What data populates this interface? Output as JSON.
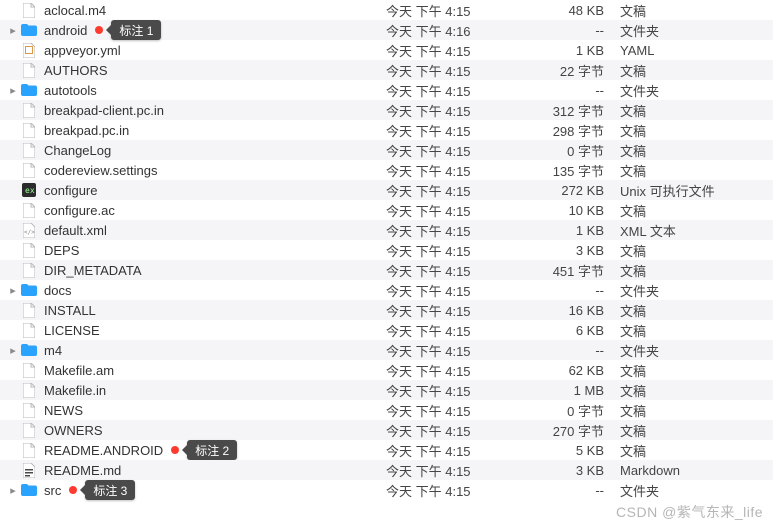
{
  "icon_colors": {
    "folder": "#2aa3ff",
    "file_border": "#b9b9b9",
    "file_fill": "#ffffff",
    "exec_fill": "#2b2b2b",
    "md_bar": "#4a4a4a"
  },
  "watermark": "CSDN @紫气东来_life",
  "rows": [
    {
      "name": "aclocal.m4",
      "date": "今天 下午 4:15",
      "size": "48 KB",
      "kind": "文稿",
      "icon": "file",
      "expandable": false,
      "marked": false,
      "annot": null
    },
    {
      "name": "android",
      "date": "今天 下午 4:16",
      "size": "--",
      "kind": "文件夹",
      "icon": "folder",
      "expandable": true,
      "marked": true,
      "annot": "标注 1"
    },
    {
      "name": "appveyor.yml",
      "date": "今天 下午 4:15",
      "size": "1 KB",
      "kind": "YAML",
      "icon": "yaml",
      "expandable": false,
      "marked": false,
      "annot": null
    },
    {
      "name": "AUTHORS",
      "date": "今天 下午 4:15",
      "size": "22 字节",
      "kind": "文稿",
      "icon": "file",
      "expandable": false,
      "marked": false,
      "annot": null
    },
    {
      "name": "autotools",
      "date": "今天 下午 4:15",
      "size": "--",
      "kind": "文件夹",
      "icon": "folder",
      "expandable": true,
      "marked": false,
      "annot": null
    },
    {
      "name": "breakpad-client.pc.in",
      "date": "今天 下午 4:15",
      "size": "312 字节",
      "kind": "文稿",
      "icon": "file",
      "expandable": false,
      "marked": false,
      "annot": null
    },
    {
      "name": "breakpad.pc.in",
      "date": "今天 下午 4:15",
      "size": "298 字节",
      "kind": "文稿",
      "icon": "file",
      "expandable": false,
      "marked": false,
      "annot": null
    },
    {
      "name": "ChangeLog",
      "date": "今天 下午 4:15",
      "size": "0 字节",
      "kind": "文稿",
      "icon": "file",
      "expandable": false,
      "marked": false,
      "annot": null
    },
    {
      "name": "codereview.settings",
      "date": "今天 下午 4:15",
      "size": "135 字节",
      "kind": "文稿",
      "icon": "file",
      "expandable": false,
      "marked": false,
      "annot": null
    },
    {
      "name": "configure",
      "date": "今天 下午 4:15",
      "size": "272 KB",
      "kind": "Unix 可执行文件",
      "icon": "exec",
      "expandable": false,
      "marked": false,
      "annot": null
    },
    {
      "name": "configure.ac",
      "date": "今天 下午 4:15",
      "size": "10 KB",
      "kind": "文稿",
      "icon": "file",
      "expandable": false,
      "marked": false,
      "annot": null
    },
    {
      "name": "default.xml",
      "date": "今天 下午 4:15",
      "size": "1 KB",
      "kind": "XML 文本",
      "icon": "xml",
      "expandable": false,
      "marked": false,
      "annot": null
    },
    {
      "name": "DEPS",
      "date": "今天 下午 4:15",
      "size": "3 KB",
      "kind": "文稿",
      "icon": "file",
      "expandable": false,
      "marked": false,
      "annot": null
    },
    {
      "name": "DIR_METADATA",
      "date": "今天 下午 4:15",
      "size": "451 字节",
      "kind": "文稿",
      "icon": "file",
      "expandable": false,
      "marked": false,
      "annot": null
    },
    {
      "name": "docs",
      "date": "今天 下午 4:15",
      "size": "--",
      "kind": "文件夹",
      "icon": "folder",
      "expandable": true,
      "marked": false,
      "annot": null
    },
    {
      "name": "INSTALL",
      "date": "今天 下午 4:15",
      "size": "16 KB",
      "kind": "文稿",
      "icon": "file",
      "expandable": false,
      "marked": false,
      "annot": null
    },
    {
      "name": "LICENSE",
      "date": "今天 下午 4:15",
      "size": "6 KB",
      "kind": "文稿",
      "icon": "file",
      "expandable": false,
      "marked": false,
      "annot": null
    },
    {
      "name": "m4",
      "date": "今天 下午 4:15",
      "size": "--",
      "kind": "文件夹",
      "icon": "folder",
      "expandable": true,
      "marked": false,
      "annot": null
    },
    {
      "name": "Makefile.am",
      "date": "今天 下午 4:15",
      "size": "62 KB",
      "kind": "文稿",
      "icon": "file",
      "expandable": false,
      "marked": false,
      "annot": null
    },
    {
      "name": "Makefile.in",
      "date": "今天 下午 4:15",
      "size": "1 MB",
      "kind": "文稿",
      "icon": "file",
      "expandable": false,
      "marked": false,
      "annot": null
    },
    {
      "name": "NEWS",
      "date": "今天 下午 4:15",
      "size": "0 字节",
      "kind": "文稿",
      "icon": "file",
      "expandable": false,
      "marked": false,
      "annot": null
    },
    {
      "name": "OWNERS",
      "date": "今天 下午 4:15",
      "size": "270 字节",
      "kind": "文稿",
      "icon": "file",
      "expandable": false,
      "marked": false,
      "annot": null
    },
    {
      "name": "README.ANDROID",
      "date": "今天 下午 4:15",
      "size": "5 KB",
      "kind": "文稿",
      "icon": "file",
      "expandable": false,
      "marked": true,
      "annot": "标注 2"
    },
    {
      "name": "README.md",
      "date": "今天 下午 4:15",
      "size": "3 KB",
      "kind": "Markdown",
      "icon": "md",
      "expandable": false,
      "marked": false,
      "annot": null
    },
    {
      "name": "src",
      "date": "今天 下午 4:15",
      "size": "--",
      "kind": "文件夹",
      "icon": "folder",
      "expandable": true,
      "marked": true,
      "annot": "标注 3"
    }
  ]
}
